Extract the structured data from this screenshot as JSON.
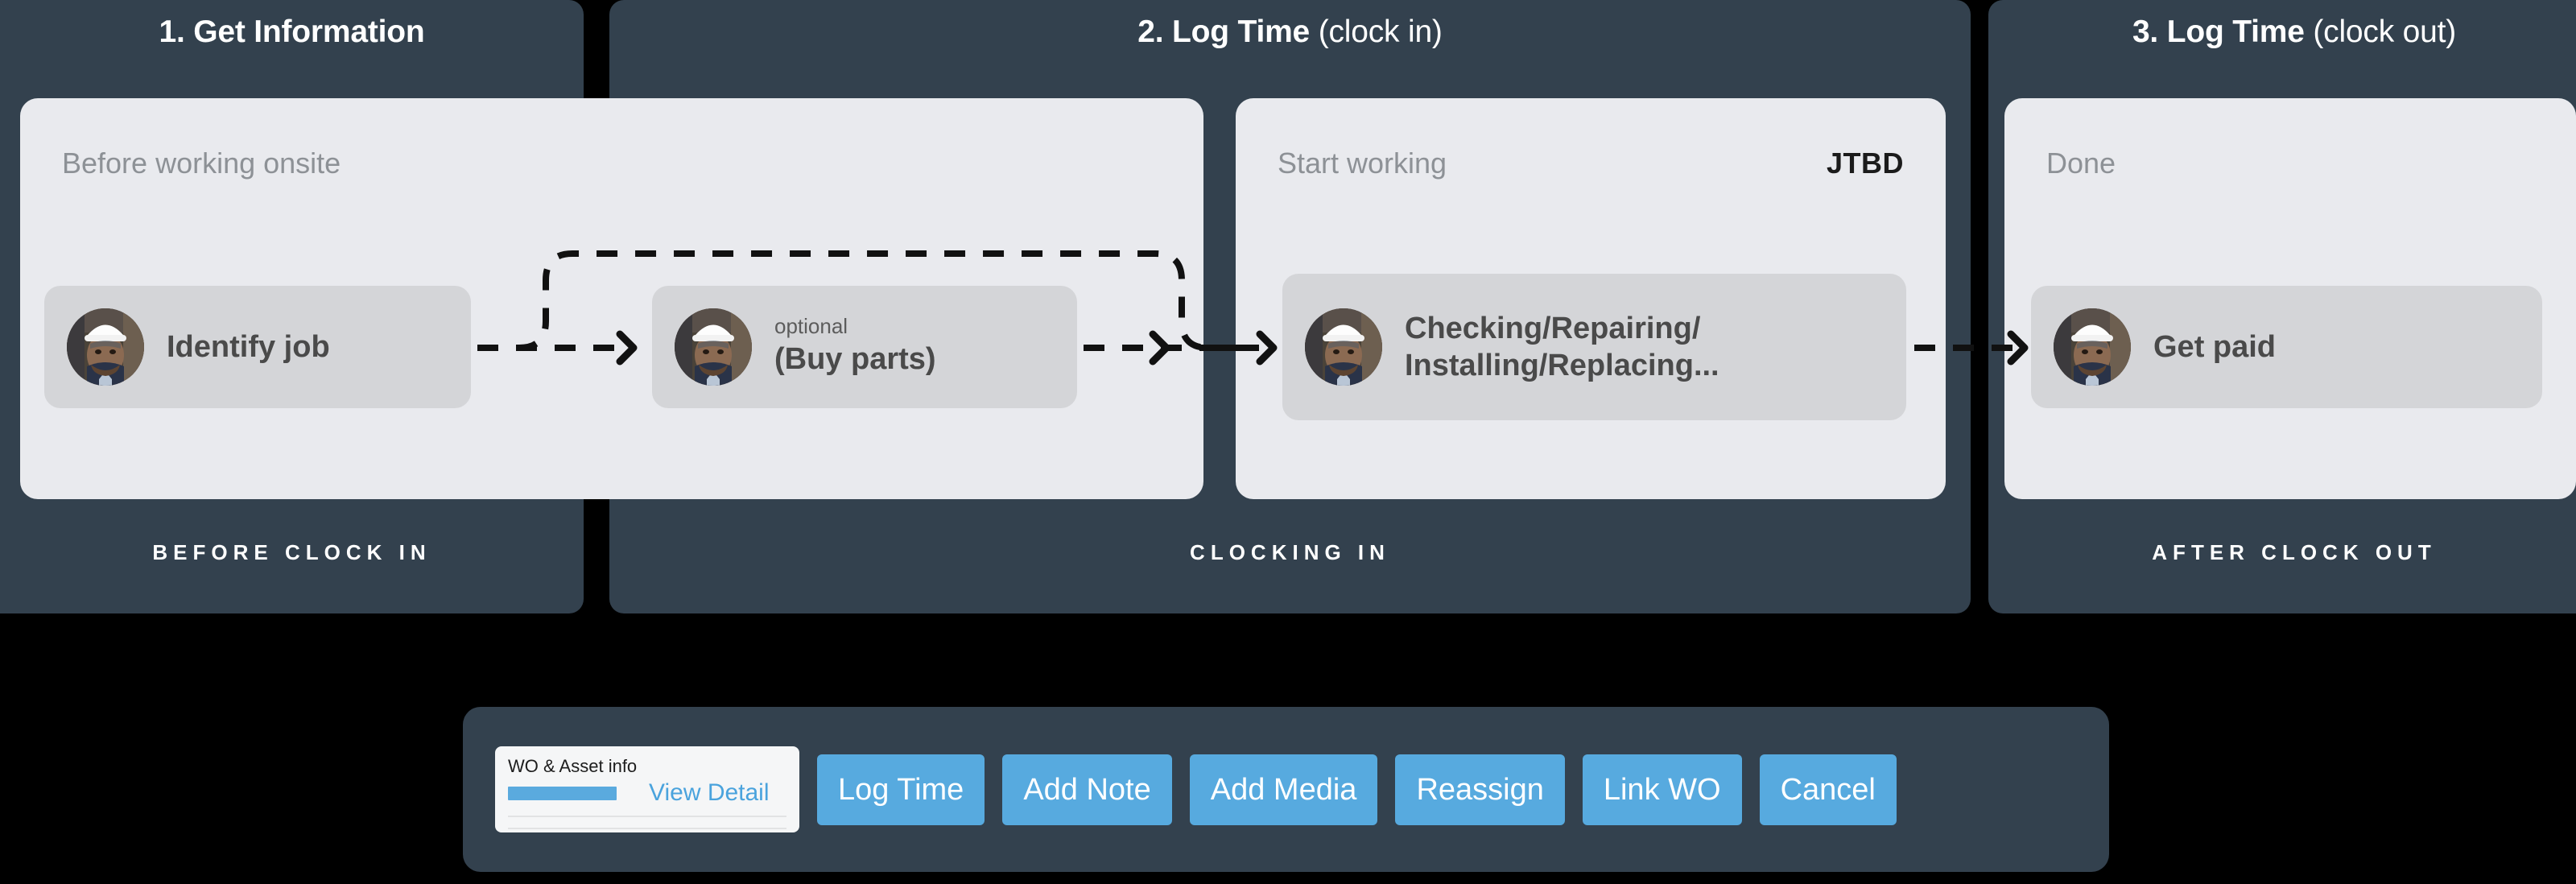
{
  "phases": [
    {
      "number": "1.",
      "title_bold": "1. Get Information",
      "title_soft": "",
      "footer": "BEFORE CLOCK IN"
    },
    {
      "number": "2.",
      "title_bold": "2. Log Time",
      "title_soft": " (clock in)",
      "footer": "CLOCKING IN"
    },
    {
      "number": "3.",
      "title_bold": "3. Log Time",
      "title_soft": " (clock out)",
      "footer": "AFTER CLOCK OUT"
    }
  ],
  "lanes": [
    {
      "caption": "Before working onsite",
      "tag": ""
    },
    {
      "caption": "Start working",
      "tag": "JTBD"
    },
    {
      "caption": "Done",
      "tag": ""
    }
  ],
  "steps": [
    {
      "sub": "",
      "label": "Identify job"
    },
    {
      "sub": "optional",
      "label": "(Buy parts)"
    },
    {
      "sub": "",
      "label": "Checking/Repairing/ Installing/Replacing..."
    },
    {
      "sub": "",
      "label": "Get paid"
    }
  ],
  "action_bar": {
    "wo_card": {
      "title": "WO & Asset info",
      "link": "View Detail"
    },
    "buttons": [
      {
        "label": "Log Time"
      },
      {
        "label": "Add Note"
      },
      {
        "label": "Add Media"
      },
      {
        "label": "Reassign"
      },
      {
        "label": "Link WO"
      },
      {
        "label": "Cancel"
      }
    ]
  },
  "colors": {
    "page_background": "#000000",
    "phase_panel": "#33414e",
    "lane_card": "#e9eaee",
    "chip": "#d4d5d8",
    "accent_blue": "#57aadf",
    "link_blue": "#4aa3dd",
    "connector": "#111111",
    "caption_gray": "#8d9196",
    "chip_text": "#4a4a4a"
  }
}
